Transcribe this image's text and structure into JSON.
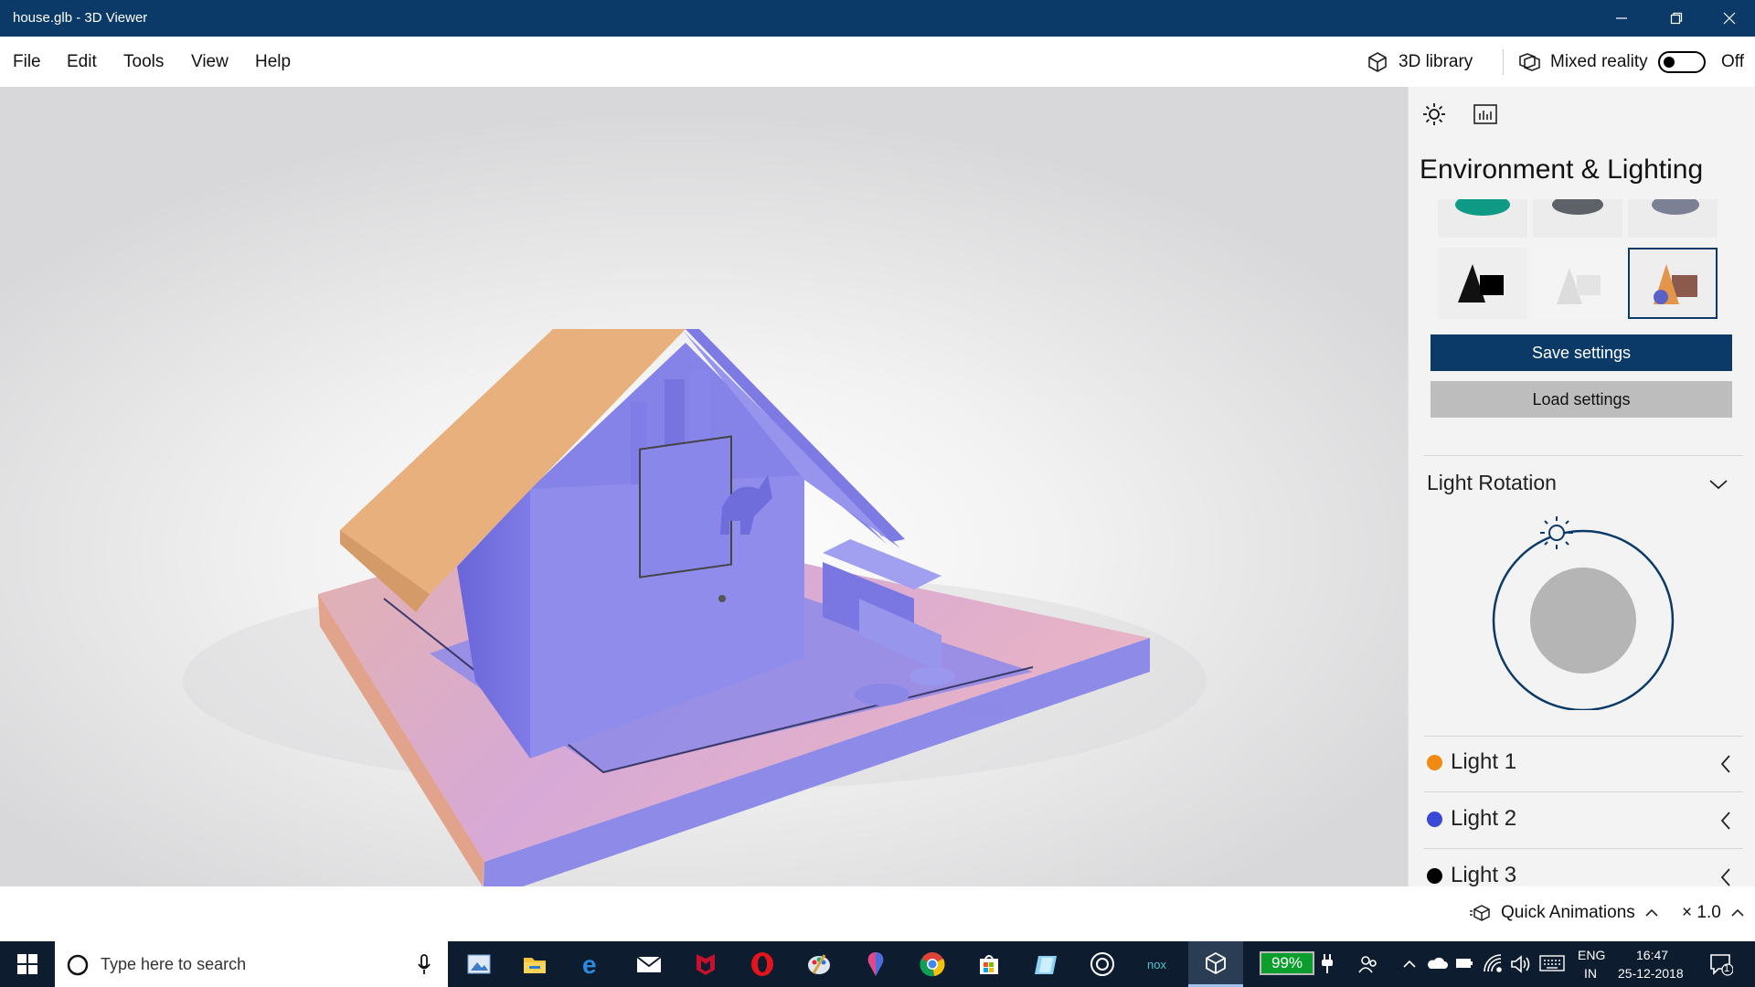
{
  "window": {
    "title": "house.glb - 3D Viewer"
  },
  "menu": {
    "items": [
      "File",
      "Edit",
      "Tools",
      "View",
      "Help"
    ],
    "library_label": "3D library",
    "mixed_reality_label": "Mixed reality",
    "mixed_reality_state": "Off"
  },
  "panel": {
    "title": "Environment & Lighting",
    "save_label": "Save settings",
    "load_label": "Load settings",
    "light_rotation_label": "Light Rotation",
    "lights": [
      {
        "label": "Light 1",
        "color": "#f08a12"
      },
      {
        "label": "Light 2",
        "color": "#3b4ad6"
      },
      {
        "label": "Light 3",
        "color": "#000000"
      }
    ]
  },
  "statusbar": {
    "quick_animations_label": "Quick Animations",
    "speed_label": "× 1.0"
  },
  "taskbar": {
    "search_placeholder": "Type here to search",
    "battery": "99%",
    "lang_top": "ENG",
    "lang_bottom": "IN",
    "time": "16:47",
    "date": "25-12-2018",
    "notification_count": "1"
  },
  "colors": {
    "accent": "#0b3a68",
    "house": "#8a87ea",
    "roof": "#e8b07c",
    "base": "#d7a7a6"
  }
}
